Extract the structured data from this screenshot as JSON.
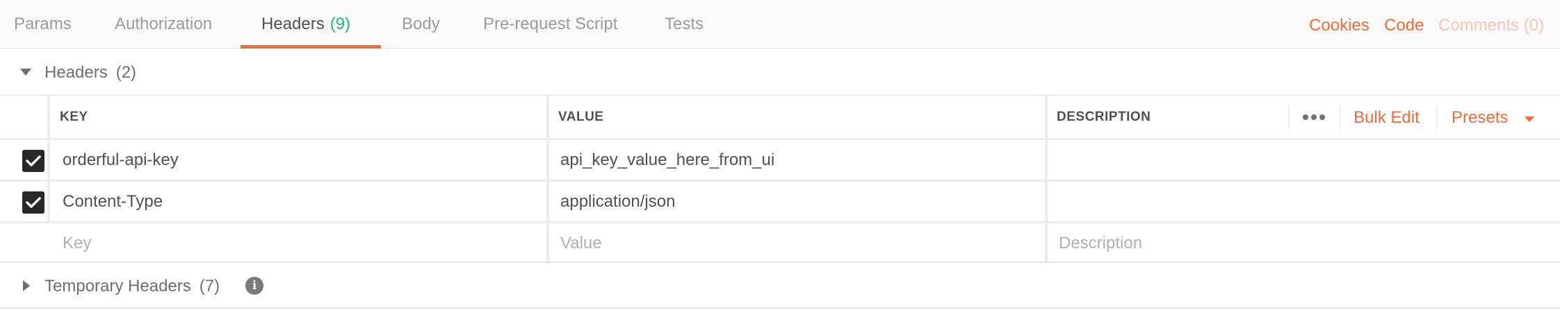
{
  "tabs": [
    {
      "label": "Params"
    },
    {
      "label": "Authorization"
    },
    {
      "label": "Headers",
      "count": "(9)"
    },
    {
      "label": "Body"
    },
    {
      "label": "Pre-request Script"
    },
    {
      "label": "Tests"
    }
  ],
  "active_tab": "Headers",
  "right_links": {
    "cookies": "Cookies",
    "code": "Code",
    "comments": "Comments (0)"
  },
  "headers_section": {
    "title": "Headers",
    "count": "(2)"
  },
  "table": {
    "columns": {
      "key": "KEY",
      "value": "VALUE",
      "description": "DESCRIPTION"
    },
    "actions": {
      "more": "more-options",
      "bulk_edit": "Bulk Edit",
      "presets": "Presets"
    },
    "rows": [
      {
        "checked": true,
        "key": "orderful-api-key",
        "value": "api_key_value_here_from_ui",
        "description": ""
      },
      {
        "checked": true,
        "key": "Content-Type",
        "value": "application/json",
        "description": ""
      }
    ],
    "placeholders": {
      "key": "Key",
      "value": "Value",
      "description": "Description"
    }
  },
  "temporary_section": {
    "title": "Temporary Headers",
    "count": "(7)",
    "info_icon": "i"
  },
  "colors": {
    "accent": "#f26b3a",
    "count_green": "#26b47f",
    "checkbox": "#282828"
  }
}
